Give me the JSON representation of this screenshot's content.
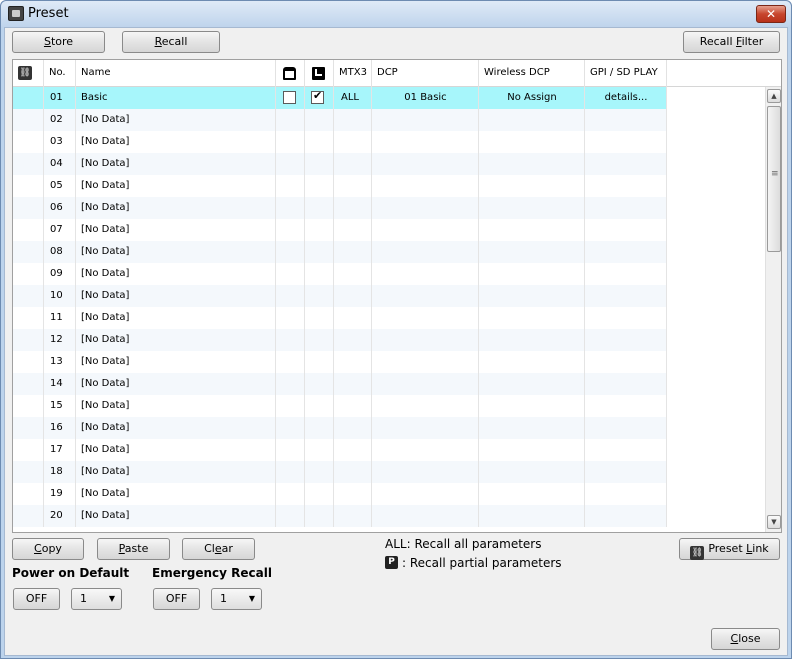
{
  "window": {
    "title": "Preset",
    "close_glyph": "✕"
  },
  "toolbar": {
    "store_pre": "",
    "store_key": "S",
    "store_post": "tore",
    "recall_pre": "",
    "recall_key": "R",
    "recall_post": "ecall",
    "recall_filter_pre": "Recall ",
    "recall_filter_key": "F",
    "recall_filter_post": "ilter"
  },
  "table": {
    "columns": {
      "no": "No.",
      "name": "Name",
      "mtx3": "MTX3",
      "dcp": "DCP",
      "wireless_dcp": "Wireless DCP",
      "gpi_sd_play": "GPI / SD PLAY"
    },
    "rows": [
      {
        "no": "01",
        "name": "Basic",
        "mtx3": "ALL",
        "dcp": "01 Basic",
        "wireless_dcp": "No Assign",
        "gpi": "details..."
      },
      {
        "no": "02",
        "name": "[No Data]"
      },
      {
        "no": "03",
        "name": "[No Data]"
      },
      {
        "no": "04",
        "name": "[No Data]"
      },
      {
        "no": "05",
        "name": "[No Data]"
      },
      {
        "no": "06",
        "name": "[No Data]"
      },
      {
        "no": "07",
        "name": "[No Data]"
      },
      {
        "no": "08",
        "name": "[No Data]"
      },
      {
        "no": "09",
        "name": "[No Data]"
      },
      {
        "no": "10",
        "name": "[No Data]"
      },
      {
        "no": "11",
        "name": "[No Data]"
      },
      {
        "no": "12",
        "name": "[No Data]"
      },
      {
        "no": "13",
        "name": "[No Data]"
      },
      {
        "no": "14",
        "name": "[No Data]"
      },
      {
        "no": "15",
        "name": "[No Data]"
      },
      {
        "no": "16",
        "name": "[No Data]"
      },
      {
        "no": "17",
        "name": "[No Data]"
      },
      {
        "no": "18",
        "name": "[No Data]"
      },
      {
        "no": "19",
        "name": "[No Data]"
      },
      {
        "no": "20",
        "name": "[No Data]"
      }
    ]
  },
  "edit": {
    "copy_key": "C",
    "copy_post": "opy",
    "paste_key": "P",
    "paste_post": "aste",
    "clear_pre": "Cl",
    "clear_key": "e",
    "clear_post": "ar"
  },
  "legend": {
    "all": "ALL: Recall all parameters",
    "partial_badge": "P",
    "partial": ": Recall partial parameters"
  },
  "preset_link": {
    "pre": "Preset ",
    "key": "L",
    "post": "ink"
  },
  "power_on_default": {
    "label": "Power on Default",
    "value": "OFF",
    "select": "1"
  },
  "emergency_recall": {
    "label": "Emergency Recall",
    "value": "OFF",
    "select": "1"
  },
  "close": {
    "key": "C",
    "post": "lose"
  },
  "colors": {
    "selected_row": "#a7f6fb",
    "title_bar": "#bfd4ec",
    "close_button": "#c7452d"
  }
}
